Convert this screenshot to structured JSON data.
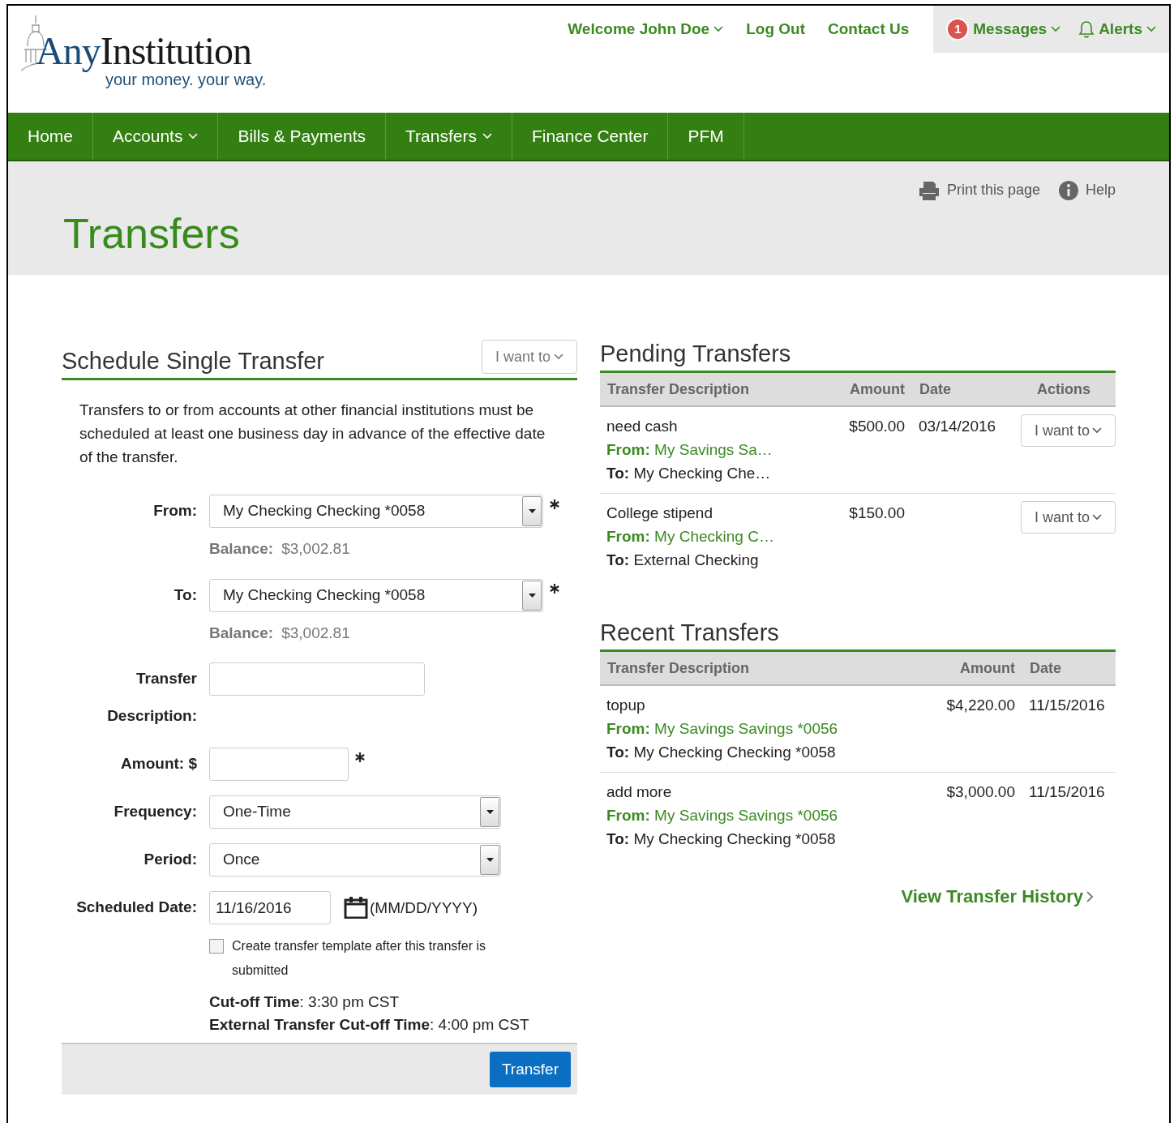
{
  "logo": {
    "brand_first": "Any",
    "brand_rest": "Institution",
    "tagline": "your money. your way."
  },
  "top_links": [
    {
      "label": "Welcome John Doe",
      "kind": "dropdown"
    },
    {
      "label": "Log Out",
      "kind": "link"
    },
    {
      "label": "Contact Us",
      "kind": "link"
    },
    {
      "label": "Messages",
      "kind": "messages",
      "badge": "1"
    },
    {
      "label": "Alerts",
      "kind": "alerts"
    }
  ],
  "nav": [
    {
      "label": "Home",
      "dropdown": false
    },
    {
      "label": "Accounts",
      "dropdown": true
    },
    {
      "label": "Bills & Payments",
      "dropdown": false
    },
    {
      "label": "Transfers",
      "dropdown": true
    },
    {
      "label": "Finance Center",
      "dropdown": false
    },
    {
      "label": "PFM",
      "dropdown": false
    }
  ],
  "page": {
    "title": "Transfers",
    "tools": [
      {
        "label": "Print this page",
        "kind": "print"
      },
      {
        "label": "Help",
        "kind": "help"
      }
    ]
  },
  "schedule": {
    "title": "Schedule Single Transfer",
    "menu": "I want to",
    "notice": "Transfers to or from accounts at other financial institutions must be scheduled at least one business day in advance of the effective date of the transfer.",
    "fields": [
      {
        "kind": "select",
        "label": "From:",
        "value": "My Checking Checking *0058",
        "required": true,
        "balance_label": "Balance:",
        "balance": "$3,002.81"
      },
      {
        "kind": "select",
        "label": "To:",
        "value": "My Checking Checking *0058",
        "required": true,
        "balance_label": "Balance:",
        "balance": "$3,002.81"
      },
      {
        "kind": "text",
        "label": "Transfer Description:",
        "required": false
      },
      {
        "kind": "amount",
        "label": "Amount: $",
        "required": true
      },
      {
        "kind": "short_select",
        "label": "Frequency:",
        "value": "One-Time",
        "required": false
      },
      {
        "kind": "short_select",
        "label": "Period:",
        "value": "Once",
        "required": false
      },
      {
        "kind": "date",
        "label": "Scheduled Date:",
        "value": "11/16/2016",
        "hint": "(MM/DD/YYYY)",
        "required": false
      }
    ],
    "template_option": {
      "label": "Create transfer template after this transfer is submitted",
      "checked": false
    },
    "cutoffs": [
      "**Cut-off Time**: 3:30 pm CST",
      "**External Transfer Cut-off Time**: 4:00 pm CST"
    ],
    "submit": "Transfer"
  },
  "pending": {
    "title": "Pending Transfers",
    "columns": [
      "Transfer Description",
      "Amount",
      "Date",
      "Actions"
    ],
    "rows": [
      {
        "description": "need cash",
        "from": "**From:** My Savings Sa…",
        "to": "**To:** My Checking Che…",
        "amount": "$500.00",
        "date": "03/14/2016",
        "action": "I want to"
      },
      {
        "description": "College stipend",
        "from": "**From:** My Checking C…",
        "to": "**To:** External Checking",
        "amount": "$150.00",
        "action": "I want to"
      }
    ]
  },
  "recent": {
    "title": "Recent Transfers",
    "columns": [
      "Transfer Description",
      "Amount",
      "Date"
    ],
    "rows": [
      {
        "description": "topup",
        "from": "**From:** My Savings Savings *0056",
        "to": "**To:** My Checking Checking *0058",
        "amount": "$4,220.00",
        "date": "11/15/2016"
      },
      {
        "description": "add more",
        "from": "**From:** My Savings Savings *0056",
        "to": "**To:** My Checking Checking *0058",
        "amount": "$3,000.00",
        "date": "11/15/2016"
      }
    ],
    "history_link": "View Transfer History"
  }
}
